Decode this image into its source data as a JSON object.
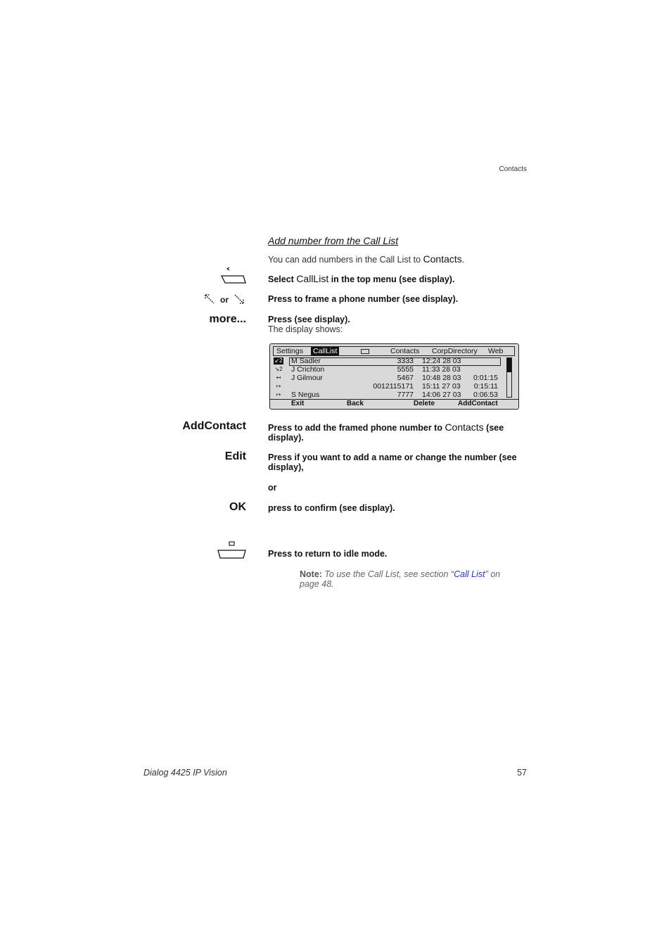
{
  "header": {
    "section": "Contacts"
  },
  "section_title": "Add number from the Call List",
  "intro": {
    "text": "You can add numbers in the Call List to ",
    "ui": "Contacts",
    "end": "."
  },
  "steps": {
    "select": {
      "a": "Select ",
      "ui": "CallList",
      "b": " in the top menu (see display)."
    },
    "frame": {
      "text": "Press to frame a phone number (see display).",
      "or": "or"
    },
    "more": {
      "key": "more...",
      "text": "Press (see display).",
      "sub": "The display shows:"
    },
    "addcontact": {
      "key": "AddContact",
      "a": "Press to add the framed phone number to ",
      "ui": "Contacts",
      "b": " (see display)."
    },
    "edit": {
      "key": "Edit",
      "text": "Press if you want to add a name or change the number (see display),",
      "or": "or"
    },
    "ok": {
      "key": "OK",
      "text": "press to confirm (see display)."
    },
    "idle": {
      "text": "Press to return to idle mode."
    }
  },
  "display": {
    "menu": [
      "Settings",
      "CallList",
      "Contacts",
      "CorpDirectory",
      "Web"
    ],
    "active_menu": "CallList",
    "rows": [
      {
        "icon": "A2",
        "name": "M Sadler",
        "number": "3333",
        "datetime": "12:24 28 03",
        "duration": ""
      },
      {
        "icon": "x2",
        "name": "J Crichton",
        "number": "5555",
        "datetime": "11:33 28 03",
        "duration": ""
      },
      {
        "icon": "in",
        "name": "J Gilmour",
        "number": "5467",
        "datetime": "10:48 28 03",
        "duration": "0:01:15"
      },
      {
        "icon": "out",
        "name": "",
        "number": "0012115171",
        "datetime": "15:11 27 03",
        "duration": "0:15:11"
      },
      {
        "icon": "out",
        "name": "S Negus",
        "number": "7777",
        "datetime": "14:06 27 03",
        "duration": "0:06:53"
      }
    ],
    "softkeys": [
      "Exit",
      "Back",
      "Delete",
      "AddContact"
    ]
  },
  "note": {
    "label": "Note:",
    "a": " To use the Call List, see section “",
    "link": "Call List",
    "b": "” on page 48."
  },
  "footer": {
    "product": "Dialog 4425 IP Vision",
    "page": "57"
  }
}
